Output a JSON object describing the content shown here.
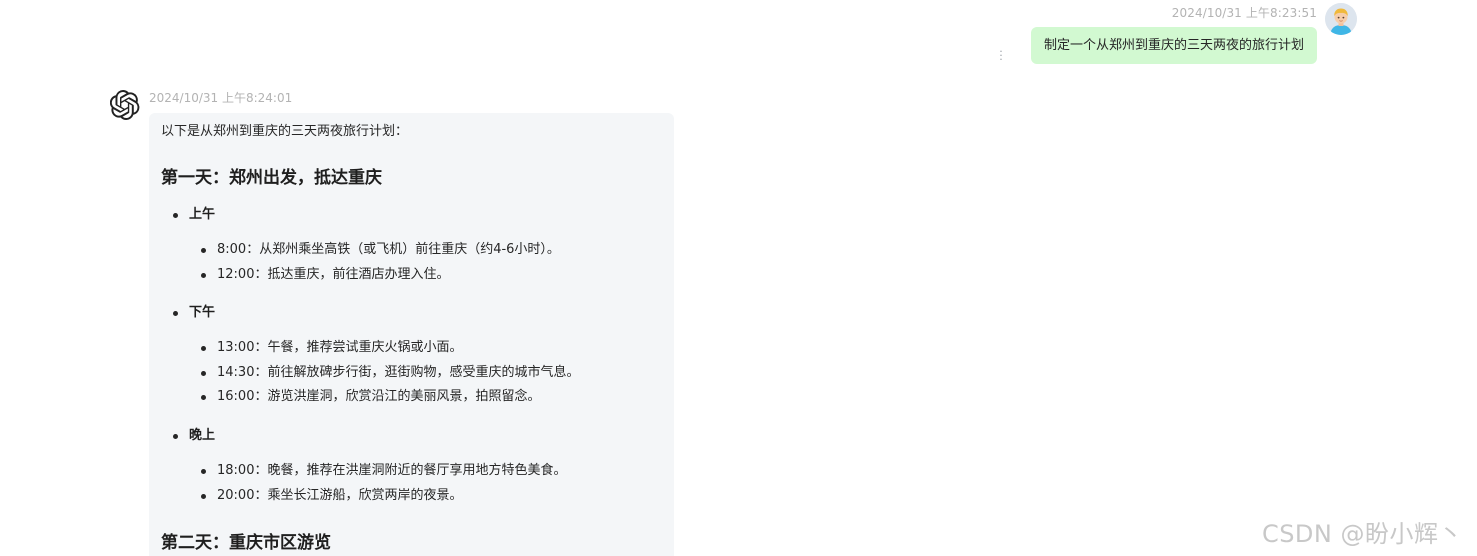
{
  "user_message": {
    "timestamp": "2024/10/31 上午8:23:51",
    "text": "制定一个从郑州到重庆的三天两夜的旅行计划"
  },
  "assistant_message": {
    "timestamp": "2024/10/31 上午8:24:01",
    "intro": "以下是从郑州到重庆的三天两夜旅行计划：",
    "days": [
      {
        "heading": "第一天：郑州出发，抵达重庆",
        "periods": [
          {
            "label": "上午",
            "items": [
              "8:00：从郑州乘坐高铁（或飞机）前往重庆（约4-6小时）。",
              "12:00：抵达重庆，前往酒店办理入住。"
            ]
          },
          {
            "label": "下午",
            "items": [
              "13:00：午餐，推荐尝试重庆火锅或小面。",
              "14:30：前往解放碑步行街，逛街购物，感受重庆的城市气息。",
              "16:00：游览洪崖洞，欣赏沿江的美丽风景，拍照留念。"
            ]
          },
          {
            "label": "晚上",
            "items": [
              "18:00：晚餐，推荐在洪崖洞附近的餐厅享用地方特色美食。",
              "20:00：乘坐长江游船，欣赏两岸的夜景。"
            ]
          }
        ]
      },
      {
        "heading": "第二天：重庆市区游览"
      }
    ]
  },
  "watermark": "CSDN @盼小辉丶",
  "icons": {
    "user_avatar": "user-avatar-icon",
    "bot_avatar": "openai-logo-icon",
    "more": "more-vertical-icon"
  },
  "colors": {
    "user_bubble": "#d2f9d1",
    "bot_bubble": "#f4f6f8",
    "timestamp": "#b3b3b3"
  }
}
